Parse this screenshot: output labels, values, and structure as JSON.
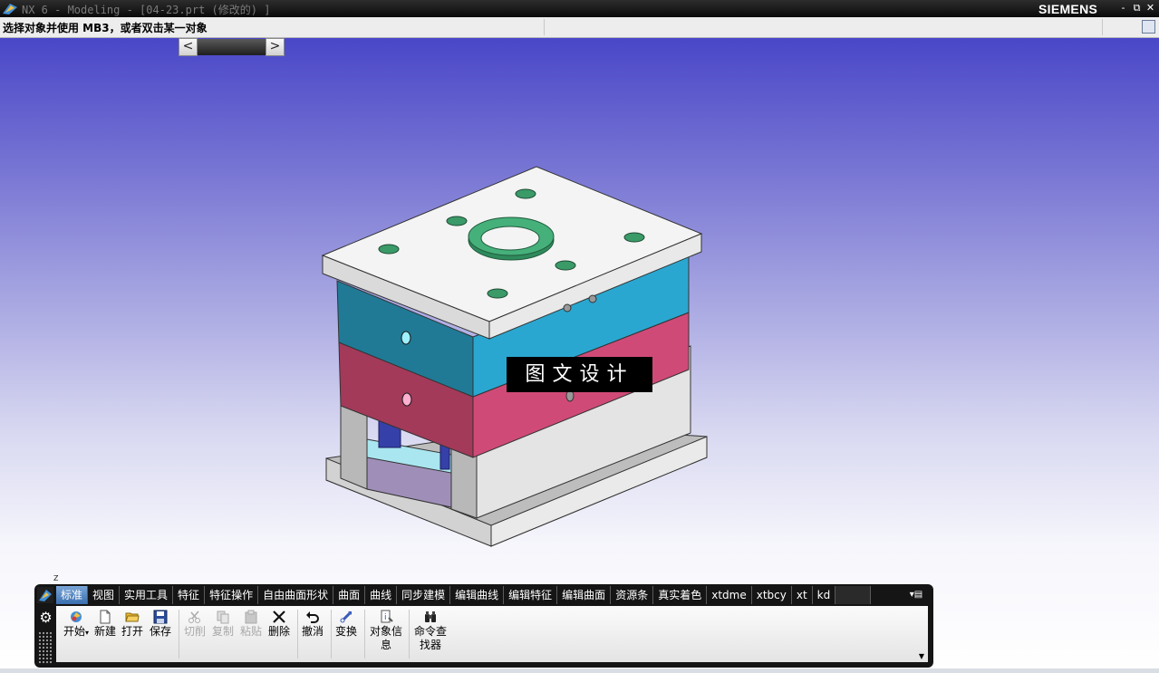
{
  "titlebar": {
    "title": "NX 6 - Modeling - [04-23.prt (修改的) ]",
    "brand": "SIEMENS",
    "buttons": [
      "-",
      "⧉",
      "✕"
    ]
  },
  "cue": {
    "prompt": "选择对象并使用 MB3，或者双击某一对象"
  },
  "viewport": {
    "watermark": "图文设计",
    "axis_label": "Z"
  },
  "ribbon": {
    "tabs": [
      "标准",
      "视图",
      "实用工具",
      "特征",
      "特征操作",
      "自由曲面形状",
      "曲面",
      "曲线",
      "同步建模",
      "编辑曲线",
      "编辑特征",
      "编辑曲面",
      "资源条",
      "真实着色",
      "xtdme",
      "xtbcy",
      "xt",
      "kd"
    ],
    "active_tab": "标准",
    "commands": {
      "start": "开始",
      "new": "新建",
      "open": "打开",
      "save": "保存",
      "cut": "切削",
      "copy": "复制",
      "paste": "粘贴",
      "delete": "删除",
      "undo": "撤消",
      "transform": "变换",
      "object_info_1": "对象信",
      "object_info_2": "息",
      "cmd_finder_1": "命令查",
      "cmd_finder_2": "找器"
    }
  },
  "colors": {
    "bg_top": "#4a47c8",
    "plate_cyan": "#2aa7d0",
    "plate_pink": "#d04a78",
    "plate_white": "#f4f4f4",
    "ring_green": "#3a9a68",
    "ribbon_active": "#3a6fae"
  }
}
